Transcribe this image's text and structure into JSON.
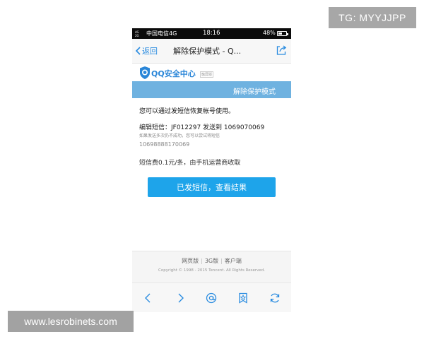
{
  "watermarks": {
    "top_right": "TG: MYYJJPP",
    "bottom_left": "www.lesrobinets.com"
  },
  "status_bar": {
    "signal_top": "4G",
    "signal_bottom": "2G",
    "carrier": "中国电信4G",
    "time": "18:16",
    "battery_percent": "48%",
    "battery_level": 0.48
  },
  "nav": {
    "back_label": "返回",
    "title": "解除保护模式 - Q..."
  },
  "brand": {
    "name": "QQ安全中心",
    "tag": "触屏版"
  },
  "section": {
    "title": "解除保护模式"
  },
  "content": {
    "headline": "您可以通过发短信恢复帐号使用。",
    "instruction": "编辑短信：JF012297 发送到 1069070069",
    "hint": "如果发送多次仍不成功，您可以尝试将短信",
    "alt_number": "10698888170069",
    "fee": "短信费0.1元/条，由手机运营商收取"
  },
  "action_button": {
    "label": "已发短信，查看结果"
  },
  "footer": {
    "links": [
      "网页版",
      "3G版",
      "客户端"
    ],
    "separator": "|",
    "copyright": "Copyright © 1998 - 2015 Tencent. All Rights Reserved."
  },
  "toolbar": {
    "icons": [
      "back-arrow-icon",
      "forward-arrow-icon",
      "at-icon",
      "bookmark-star-icon",
      "refresh-icon"
    ]
  },
  "colors": {
    "accent": "#1ea4ea",
    "section_bar": "#6fb2e0",
    "link_blue": "#2a8ce0",
    "brand_blue": "#2a86d8"
  }
}
